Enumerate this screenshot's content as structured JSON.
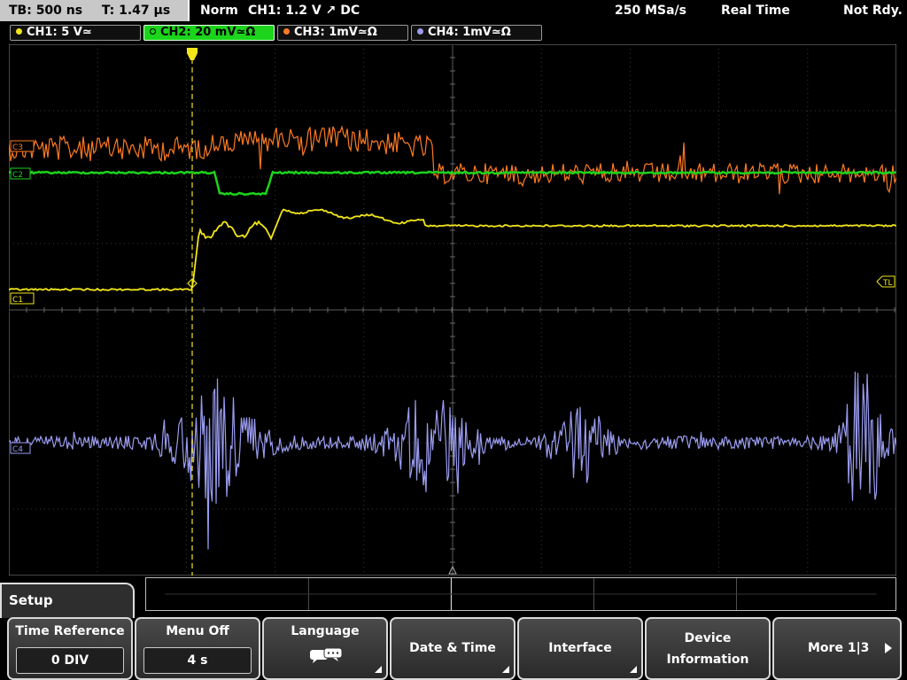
{
  "statusbar": {
    "timebase": "TB: 500 ns",
    "trigger_time": "T: 1.47 µs",
    "trigger_mode": "Norm",
    "trigger_info": "CH1: 1.2 V ↗ DC",
    "sample_rate": "250 MSa/s",
    "acq_mode": "Real Time",
    "status": "Not Rdy."
  },
  "channels": [
    {
      "label": "CH1: 5 V≃",
      "color": "#f2e61a",
      "marker": "C1"
    },
    {
      "label": "CH2: 20 mV≃Ω",
      "color": "#1bd41b",
      "marker": "C2"
    },
    {
      "label": "CH3: 1mV≃Ω",
      "color": "#ff7a22",
      "marker": "C3"
    },
    {
      "label": "CH4: 1mV≃Ω",
      "color": "#9a9cf0",
      "marker": "C4"
    }
  ],
  "markers": {
    "trigger_level": "TL"
  },
  "menu": {
    "title": "Setup",
    "softkeys": [
      {
        "label": "Time Reference",
        "value": "0 DIV"
      },
      {
        "label": "Menu Off",
        "value": "4 s"
      },
      {
        "label": "Language",
        "icon": "speech-bubble-icon"
      },
      {
        "label": "Date & Time"
      },
      {
        "label": "Interface"
      },
      {
        "label1": "Device",
        "label2": "Information"
      },
      {
        "label": "More 1|3",
        "icon": "arrow-right-icon"
      }
    ]
  }
}
